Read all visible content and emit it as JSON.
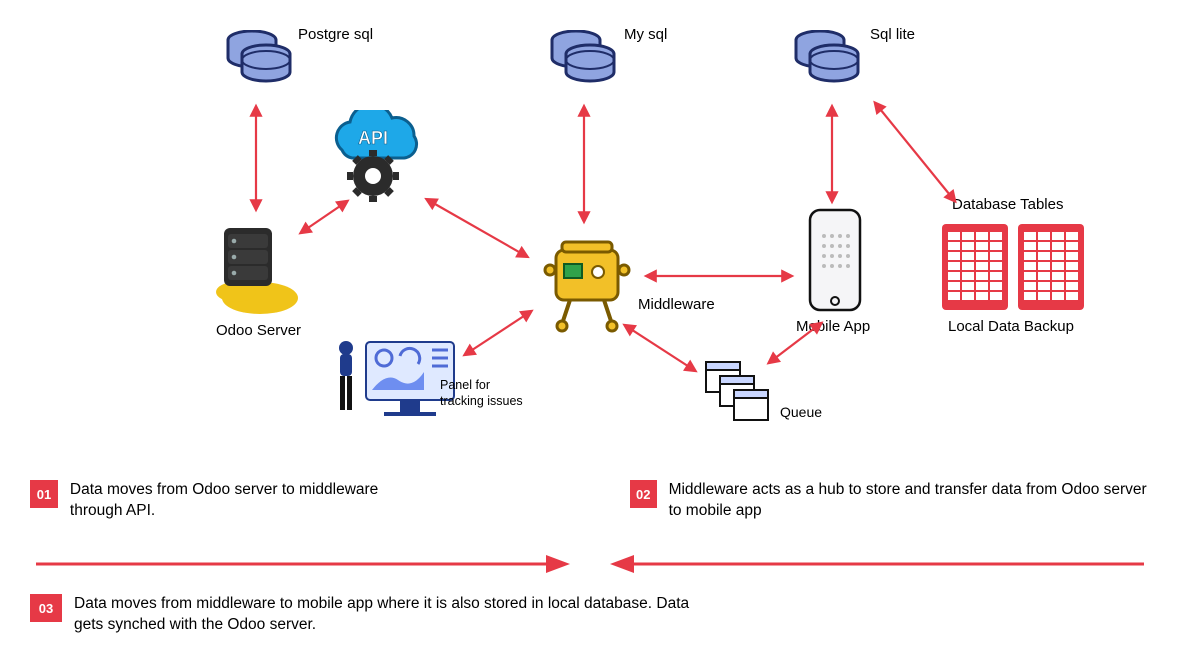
{
  "nodes": {
    "postgres": {
      "label": "Postgre sql"
    },
    "mysql": {
      "label": "My sql"
    },
    "sqllite": {
      "label": "Sql lite"
    },
    "api": {
      "label": "API"
    },
    "odoo": {
      "label": "Odoo Server"
    },
    "middleware": {
      "label": "Middleware"
    },
    "mobile": {
      "label": "Mobile App"
    },
    "db_tables": {
      "title": "Database Tables",
      "caption": "Local Data Backup"
    },
    "panel": {
      "label_line1": "Panel for",
      "label_line2": "tracking issues"
    },
    "queue": {
      "label": "Queue"
    }
  },
  "steps": {
    "s1": {
      "num": "01",
      "text": "Data moves from Odoo server to middleware through API."
    },
    "s2": {
      "num": "02",
      "text": "Middleware acts as a hub to store and transfer data from Odoo server to mobile app"
    },
    "s3": {
      "num": "03",
      "text": "Data moves from middleware to mobile app where it is also stored in local database. Data gets synched with the Odoo server."
    }
  },
  "colors": {
    "accent": "#e63946",
    "db_body": "#8fa4e0",
    "db_stroke": "#1f2d68",
    "api_cloud": "#1ea8e8",
    "api_gear": "#2b2b2b",
    "mw_body": "#f2c028",
    "mw_panel": "#2fa24a",
    "cloud": "#f0c419",
    "phone": "#f5f5f7"
  }
}
